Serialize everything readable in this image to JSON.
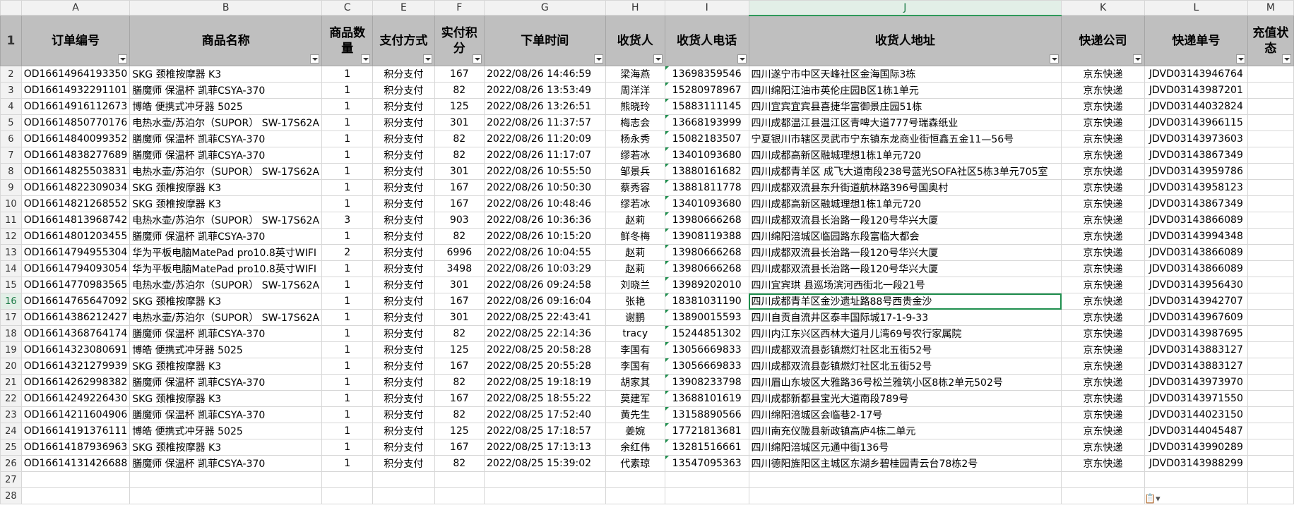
{
  "column_letters": [
    "A",
    "B",
    "C",
    "E",
    "F",
    "G",
    "H",
    "I",
    "J",
    "K",
    "L",
    "M"
  ],
  "row_numbers": [
    "1",
    "2",
    "3",
    "4",
    "5",
    "6",
    "7",
    "8",
    "9",
    "10",
    "11",
    "12",
    "13",
    "14",
    "15",
    "16",
    "17",
    "18",
    "19",
    "20",
    "21",
    "22",
    "23",
    "24",
    "25",
    "26",
    "27",
    "28"
  ],
  "selected": {
    "column": "J",
    "row": "16"
  },
  "headers": [
    "订单编号",
    "商品名称",
    "商品数量",
    "支付方式",
    "实付积分",
    "下单时间",
    "收货人",
    "收货人电话",
    "收货人地址",
    "快递公司",
    "快递单号",
    "充值状态"
  ],
  "rows": [
    [
      "OD16614964193350",
      "SKG 颈椎按摩器 K3",
      "1",
      "积分支付",
      "167",
      "2022/08/26 14:46:59",
      "梁海燕",
      "13698359546",
      "四川遂宁市中区天峰社区金海国际3栋",
      "京东快递",
      "JDVD03143946764",
      ""
    ],
    [
      "OD16614932291101",
      "膳魔师 保温杯 凯菲CSYA-370",
      "1",
      "积分支付",
      "82",
      "2022/08/26 13:53:49",
      "周洋洋",
      "15280978967",
      "四川绵阳江油市英伦庄园B区1栋1单元",
      "京东快递",
      "JDVD03143987201",
      ""
    ],
    [
      "OD16614916112673",
      "博皓 便携式冲牙器 5025",
      "1",
      "积分支付",
      "125",
      "2022/08/26 13:26:51",
      "熊晓玲",
      "15883111145",
      "四川宜宾宜宾县喜捷华富御景庄园51栋",
      "京东快递",
      "JDVD03144032824",
      ""
    ],
    [
      "OD16614850770176",
      "电热水壶/苏泊尔（SUPOR） SW-17S62A",
      "1",
      "积分支付",
      "301",
      "2022/08/26 11:37:57",
      "梅志会",
      "13668193999",
      "四川成都温江县温江区青啤大道777号瑞森纸业",
      "京东快递",
      "JDVD03143966115",
      ""
    ],
    [
      "OD16614840099352",
      "膳魔师 保温杯 凯菲CSYA-370",
      "1",
      "积分支付",
      "82",
      "2022/08/26 11:20:09",
      "杨永秀",
      "15082183507",
      "宁夏银川市辖区灵武市宁东镇东龙商业街恒鑫五金11—56号",
      "京东快递",
      "JDVD03143973603",
      ""
    ],
    [
      "OD16614838277689",
      "膳魔师 保温杯 凯菲CSYA-370",
      "1",
      "积分支付",
      "82",
      "2022/08/26 11:17:07",
      "缪若冰",
      "13401093680",
      "四川成都高新区融城理想1栋1单元720",
      "京东快递",
      "JDVD03143867349",
      ""
    ],
    [
      "OD16614825503831",
      "电热水壶/苏泊尔（SUPOR） SW-17S62A",
      "1",
      "积分支付",
      "301",
      "2022/08/26 10:55:50",
      "邹景兵",
      "13880161682",
      "四川成都青羊区 成飞大道南段238号蓝光SOFA社区5栋3单元705室",
      "京东快递",
      "JDVD03143959786",
      ""
    ],
    [
      "OD16614822309034",
      "SKG 颈椎按摩器 K3",
      "1",
      "积分支付",
      "167",
      "2022/08/26 10:50:30",
      "蔡秀容",
      "13881811778",
      "四川成都双流县东升街道航林路396号国奥村",
      "京东快递",
      "JDVD03143958123",
      ""
    ],
    [
      "OD16614821268552",
      "SKG 颈椎按摩器 K3",
      "1",
      "积分支付",
      "167",
      "2022/08/26 10:48:46",
      "缪若冰",
      "13401093680",
      "四川成都高新区融城理想1栋1单元720",
      "京东快递",
      "JDVD03143867349",
      ""
    ],
    [
      "OD16614813968742",
      "电热水壶/苏泊尔（SUPOR） SW-17S62A",
      "3",
      "积分支付",
      "903",
      "2022/08/26 10:36:36",
      "赵莉",
      "13980666268",
      "四川成都双流县长治路一段120号华兴大厦",
      "京东快递",
      "JDVD03143866089",
      ""
    ],
    [
      "OD16614801203455",
      "膳魔师 保温杯 凯菲CSYA-370",
      "1",
      "积分支付",
      "82",
      "2022/08/26 10:15:20",
      "鲜冬梅",
      "13908119388",
      "四川绵阳涪城区临园路东段富临大都会",
      "京东快递",
      "JDVD03143994348",
      ""
    ],
    [
      "OD16614794955304",
      "华为平板电脑MatePad pro10.8英寸WIFI",
      "2",
      "积分支付",
      "6996",
      "2022/08/26 10:04:55",
      "赵莉",
      "13980666268",
      "四川成都双流县长治路一段120号华兴大厦",
      "京东快递",
      "JDVD03143866089",
      ""
    ],
    [
      "OD16614794093054",
      "华为平板电脑MatePad pro10.8英寸WIFI",
      "1",
      "积分支付",
      "3498",
      "2022/08/26 10:03:29",
      "赵莉",
      "13980666268",
      "四川成都双流县长治路一段120号华兴大厦",
      "京东快递",
      "JDVD03143866089",
      ""
    ],
    [
      "OD16614770983565",
      "电热水壶/苏泊尔（SUPOR） SW-17S62A",
      "1",
      "积分支付",
      "301",
      "2022/08/26 09:24:58",
      "刘晓兰",
      "13989202010",
      "四川宜宾珙  县巡场滨河西街北一段21号",
      "京东快递",
      "JDVD03143956430",
      ""
    ],
    [
      "OD16614765647092",
      "SKG 颈椎按摩器 K3",
      "1",
      "积分支付",
      "167",
      "2022/08/26 09:16:04",
      "张艳",
      "18381031190",
      "四川成都青羊区金沙遗址路88号西贵金沙",
      "京东快递",
      "JDVD03143942707",
      ""
    ],
    [
      "OD16614386212427",
      "电热水壶/苏泊尔（SUPOR） SW-17S62A",
      "1",
      "积分支付",
      "301",
      "2022/08/25 22:43:41",
      "谢鹏",
      "13890015593",
      "四川自贡自流井区泰丰国际城17-1-9-33",
      "京东快递",
      "JDVD03143967609",
      ""
    ],
    [
      "OD16614368764174",
      "膳魔师 保温杯 凯菲CSYA-370",
      "1",
      "积分支付",
      "82",
      "2022/08/25 22:14:36",
      "tracy",
      "15244851302",
      "四川内江东兴区西林大道月儿湾69号农行家属院",
      "京东快递",
      "JDVD03143987695",
      ""
    ],
    [
      "OD16614323080691",
      "博皓 便携式冲牙器 5025",
      "1",
      "积分支付",
      "125",
      "2022/08/25 20:58:28",
      "李国有",
      "13056669833",
      "四川成都双流县彭镇燃灯社区北五街52号",
      "京东快递",
      "JDVD03143883127",
      ""
    ],
    [
      "OD16614321279939",
      "SKG 颈椎按摩器 K3",
      "1",
      "积分支付",
      "167",
      "2022/08/25 20:55:28",
      "李国有",
      "13056669833",
      "四川成都双流县彭镇燃灯社区北五街52号",
      "京东快递",
      "JDVD03143883127",
      ""
    ],
    [
      "OD16614262998382",
      "膳魔师 保温杯 凯菲CSYA-370",
      "1",
      "积分支付",
      "82",
      "2022/08/25 19:18:19",
      "胡家其",
      "13908233798",
      "四川眉山东坡区大雅路36号松兰雅筑小区8栋2单元502号",
      "京东快递",
      "JDVD03143973970",
      ""
    ],
    [
      "OD16614249226430",
      "SKG 颈椎按摩器 K3",
      "1",
      "积分支付",
      "167",
      "2022/08/25 18:55:22",
      "莫建军",
      "13688101619",
      "四川成都新都县宝光大道南段789号",
      "京东快递",
      "JDVD03143971550",
      ""
    ],
    [
      "OD16614211604906",
      "膳魔师 保温杯 凯菲CSYA-370",
      "1",
      "积分支付",
      "82",
      "2022/08/25 17:52:40",
      "黄先生",
      "13158890566",
      "四川绵阳涪城区会临巷2-17号",
      "京东快递",
      "JDVD03144023150",
      ""
    ],
    [
      "OD16614191376111",
      "博皓 便携式冲牙器 5025",
      "1",
      "积分支付",
      "125",
      "2022/08/25 17:18:57",
      "姜婉",
      "17721813681",
      "四川南充仪陇县新政镇高庐4栋二单元",
      "京东快递",
      "JDVD03144045487",
      ""
    ],
    [
      "OD16614187936963",
      "SKG 颈椎按摩器 K3",
      "1",
      "积分支付",
      "167",
      "2022/08/25 17:13:13",
      "余红伟",
      "13281516661",
      "四川绵阳涪城区元通中街136号",
      "京东快递",
      "JDVD03143990289",
      ""
    ],
    [
      "OD16614131426688",
      "膳魔师 保温杯 凯菲CSYA-370",
      "1",
      "积分支付",
      "82",
      "2022/08/25 15:39:02",
      "代素琼",
      "13547095363",
      "四川德阳旌阳区主城区东湖乡碧桂园青云台78栋2号",
      "京东快递",
      "JDVD03143988299",
      ""
    ]
  ],
  "paste_options_icon": "clipboard-icon"
}
